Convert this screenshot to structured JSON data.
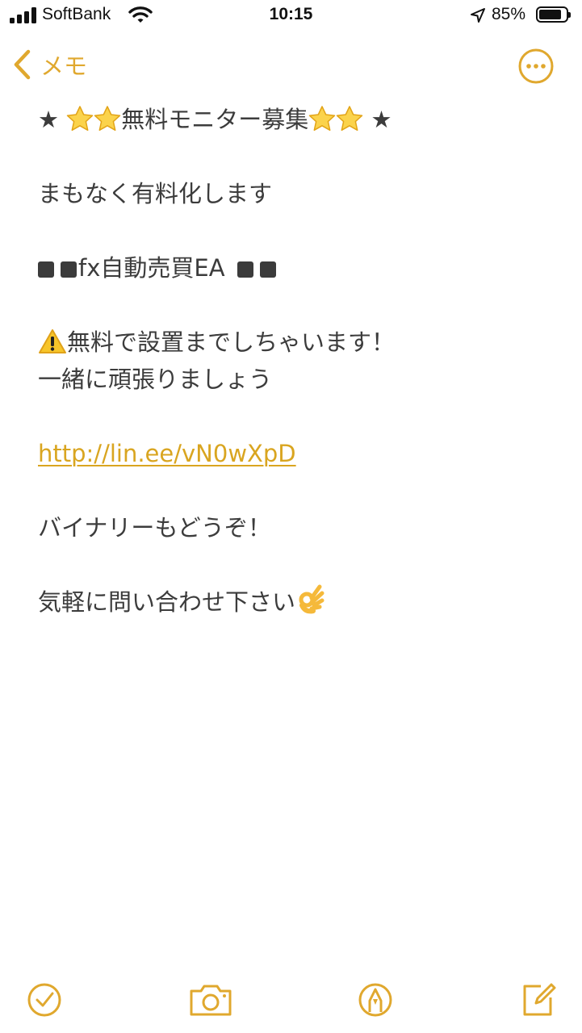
{
  "status_bar": {
    "carrier": "SoftBank",
    "time": "10:15",
    "battery_percent_text": "85%",
    "battery_level": 0.85
  },
  "nav": {
    "back_label": "メモ",
    "icons": [
      "chevron-left-icon",
      "more-options-icon"
    ]
  },
  "note": {
    "title_text": "無料モニター募集",
    "line_paid": "まもなく有料化します",
    "line_fx": "fx自動売買EA",
    "line_install": "無料で設置までしちゃいます！",
    "line_together": "一緒に頑張りましょう",
    "link": "http://lin.ee/vN0wXpD",
    "line_binary": "バイナリーもどうぞ！",
    "line_contact": "気軽に問い合わせ下さい"
  },
  "toolbar": {
    "icons": [
      "checklist-icon",
      "camera-icon",
      "markup-icon",
      "compose-icon"
    ]
  },
  "colors": {
    "accent": "#e0a82e",
    "text": "#3c3c3c",
    "background": "#ffffff"
  }
}
